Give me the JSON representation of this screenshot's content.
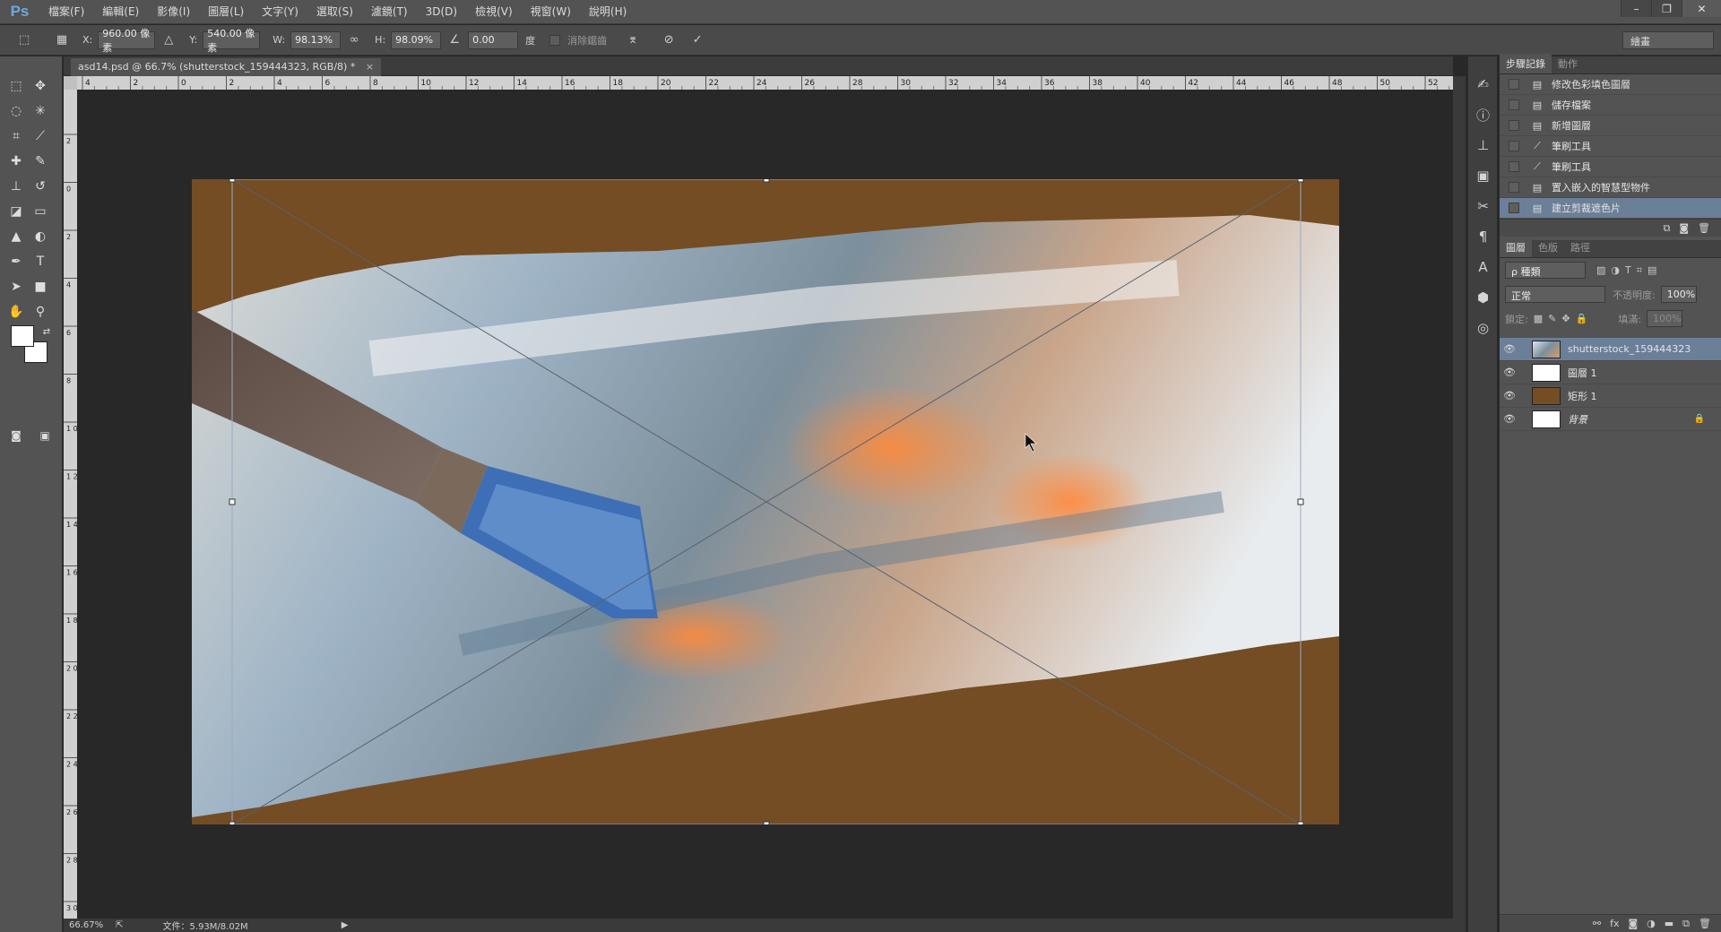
{
  "menubar": {
    "logo": "Ps",
    "items": [
      "檔案(F)",
      "編輯(E)",
      "影像(I)",
      "圖層(L)",
      "文字(Y)",
      "選取(S)",
      "濾鏡(T)",
      "3D(D)",
      "檢視(V)",
      "視窗(W)",
      "說明(H)"
    ],
    "controls": {
      "minimize": "–",
      "restore": "❐",
      "close": "✕"
    }
  },
  "options": {
    "x_label": "X:",
    "x_value": "960.00 像素",
    "y_label": "Y:",
    "y_value": "540.00 像素",
    "w_label": "W:",
    "w_value": "98.13%",
    "h_label": "H:",
    "h_value": "98.09%",
    "angle_value": "0.00",
    "angle_unit": "度",
    "antialias_label": "消除鋸齒",
    "workspace": "繪畫"
  },
  "document": {
    "tab_title": "asd14.psd @ 66.7% (shutterstock_159444323, RGB/8) *",
    "ruler_h": [
      "4",
      "2",
      "0",
      "2",
      "4",
      "6",
      "8",
      "10",
      "12",
      "14",
      "16",
      "18",
      "20",
      "22",
      "24",
      "26",
      "28",
      "30",
      "32",
      "34",
      "36",
      "38",
      "40",
      "42",
      "44",
      "46",
      "48",
      "50",
      "52"
    ],
    "ruler_v": [
      "2",
      "0",
      "2",
      "4",
      "6",
      "8",
      "1 0",
      "1 2",
      "1 4",
      "1 6",
      "1 8",
      "2 0",
      "2 2",
      "2 4",
      "2 6",
      "2 8",
      "3 0"
    ],
    "zoom": "66.67%",
    "file_info": "文件：5.93M/8.02M",
    "canvas_bg": "#744d24"
  },
  "history": {
    "tabs": [
      "步驟記錄",
      "動作"
    ],
    "items": [
      {
        "label": "修改色彩填色圖層",
        "icon": "doc"
      },
      {
        "label": "儲存檔案",
        "icon": "doc"
      },
      {
        "label": "新增圖層",
        "icon": "doc"
      },
      {
        "label": "筆刷工具",
        "icon": "brush"
      },
      {
        "label": "筆刷工具",
        "icon": "brush"
      },
      {
        "label": "置入嵌入的智慧型物件",
        "icon": "doc"
      },
      {
        "label": "建立剪裁遮色片",
        "icon": "doc",
        "active": true
      }
    ]
  },
  "layers": {
    "tabs": [
      "圖層",
      "色版",
      "路徑"
    ],
    "filter_kind": "ρ 種類",
    "blend_mode": "正常",
    "opacity_label": "不透明度:",
    "opacity_value": "100%",
    "lock_label": "鎖定:",
    "fill_label": "填滿:",
    "fill_value": "100%",
    "items": [
      {
        "name": "shutterstock_159444323",
        "thumb": "photo",
        "active": true
      },
      {
        "name": "圖層 1",
        "thumb": "#ffffff"
      },
      {
        "name": "矩形 1",
        "thumb": "#744d24"
      },
      {
        "name": "背景",
        "thumb": "#ffffff",
        "locked": true
      }
    ]
  }
}
